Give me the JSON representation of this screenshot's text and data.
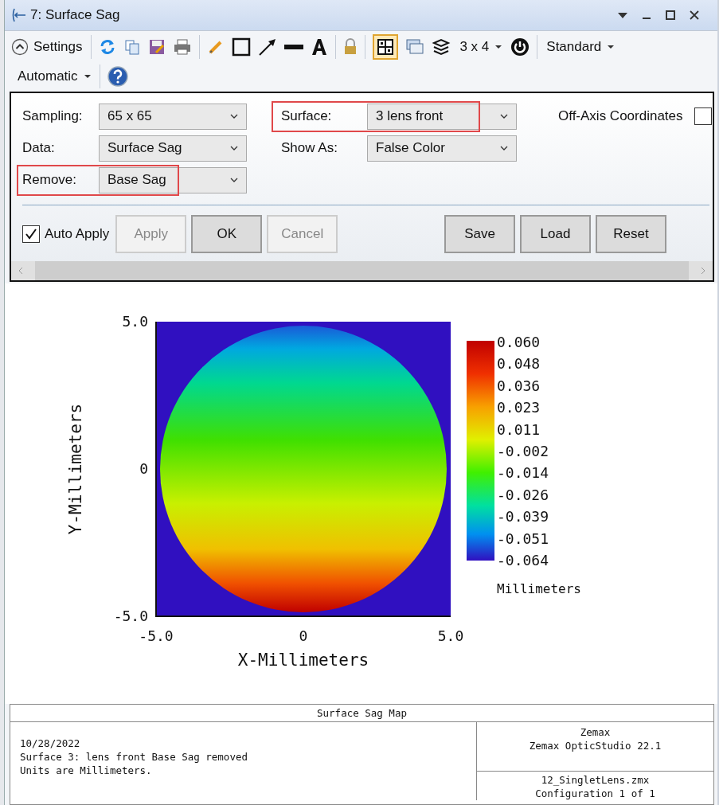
{
  "window": {
    "title": "7: Surface Sag"
  },
  "toolbar": {
    "settings": "Settings",
    "layout": "3 x 4",
    "style": "Standard",
    "zoom": "Automatic",
    "grid_selected": true
  },
  "settings": {
    "fields": [
      {
        "label": "Sampling:",
        "value": "65 x 65",
        "highlighted": false
      },
      {
        "label": "Surface:",
        "value": "3 lens front",
        "highlighted": true
      },
      {
        "label": "Data:",
        "value": "Surface Sag",
        "highlighted": false
      },
      {
        "label": "Show As:",
        "value": "False Color",
        "highlighted": false
      },
      {
        "label": "Remove:",
        "value": "Base Sag",
        "highlighted": true
      }
    ],
    "off_axis": {
      "label": "Off-Axis Coordinates",
      "checked": false
    },
    "auto_apply": {
      "label": "Auto Apply",
      "checked": true
    },
    "buttons": [
      {
        "label": "Apply",
        "disabled": true
      },
      {
        "label": "OK",
        "disabled": false
      },
      {
        "label": "Cancel",
        "disabled": true
      }
    ],
    "file_buttons": [
      {
        "label": "Save",
        "disabled": false
      },
      {
        "label": "Load",
        "disabled": false
      },
      {
        "label": "Reset",
        "disabled": false
      }
    ]
  },
  "plot": {
    "y_label": "Y-Millimeters",
    "x_label": "X-Millimeters",
    "y_ticks": [
      "5.0",
      "0",
      "-5.0"
    ],
    "x_ticks": [
      "-5.0",
      "0",
      "5.0"
    ],
    "colorbar_labels": [
      "0.060",
      "0.048",
      "0.036",
      "0.023",
      "0.011",
      "-0.002",
      "-0.014",
      "-0.026",
      "-0.039",
      "-0.051",
      "-0.064"
    ],
    "units": "Millimeters"
  },
  "footer": {
    "title": "Surface Sag Map",
    "left_lines": [
      "10/28/2022",
      "Surface 3: lens front Base Sag removed",
      "Units are Millimeters."
    ],
    "right_top": [
      "Zemax",
      "Zemax OpticStudio 22.1"
    ],
    "right_bottom": [
      "12_SingletLens.zmx",
      "Configuration 1 of 1"
    ]
  }
}
